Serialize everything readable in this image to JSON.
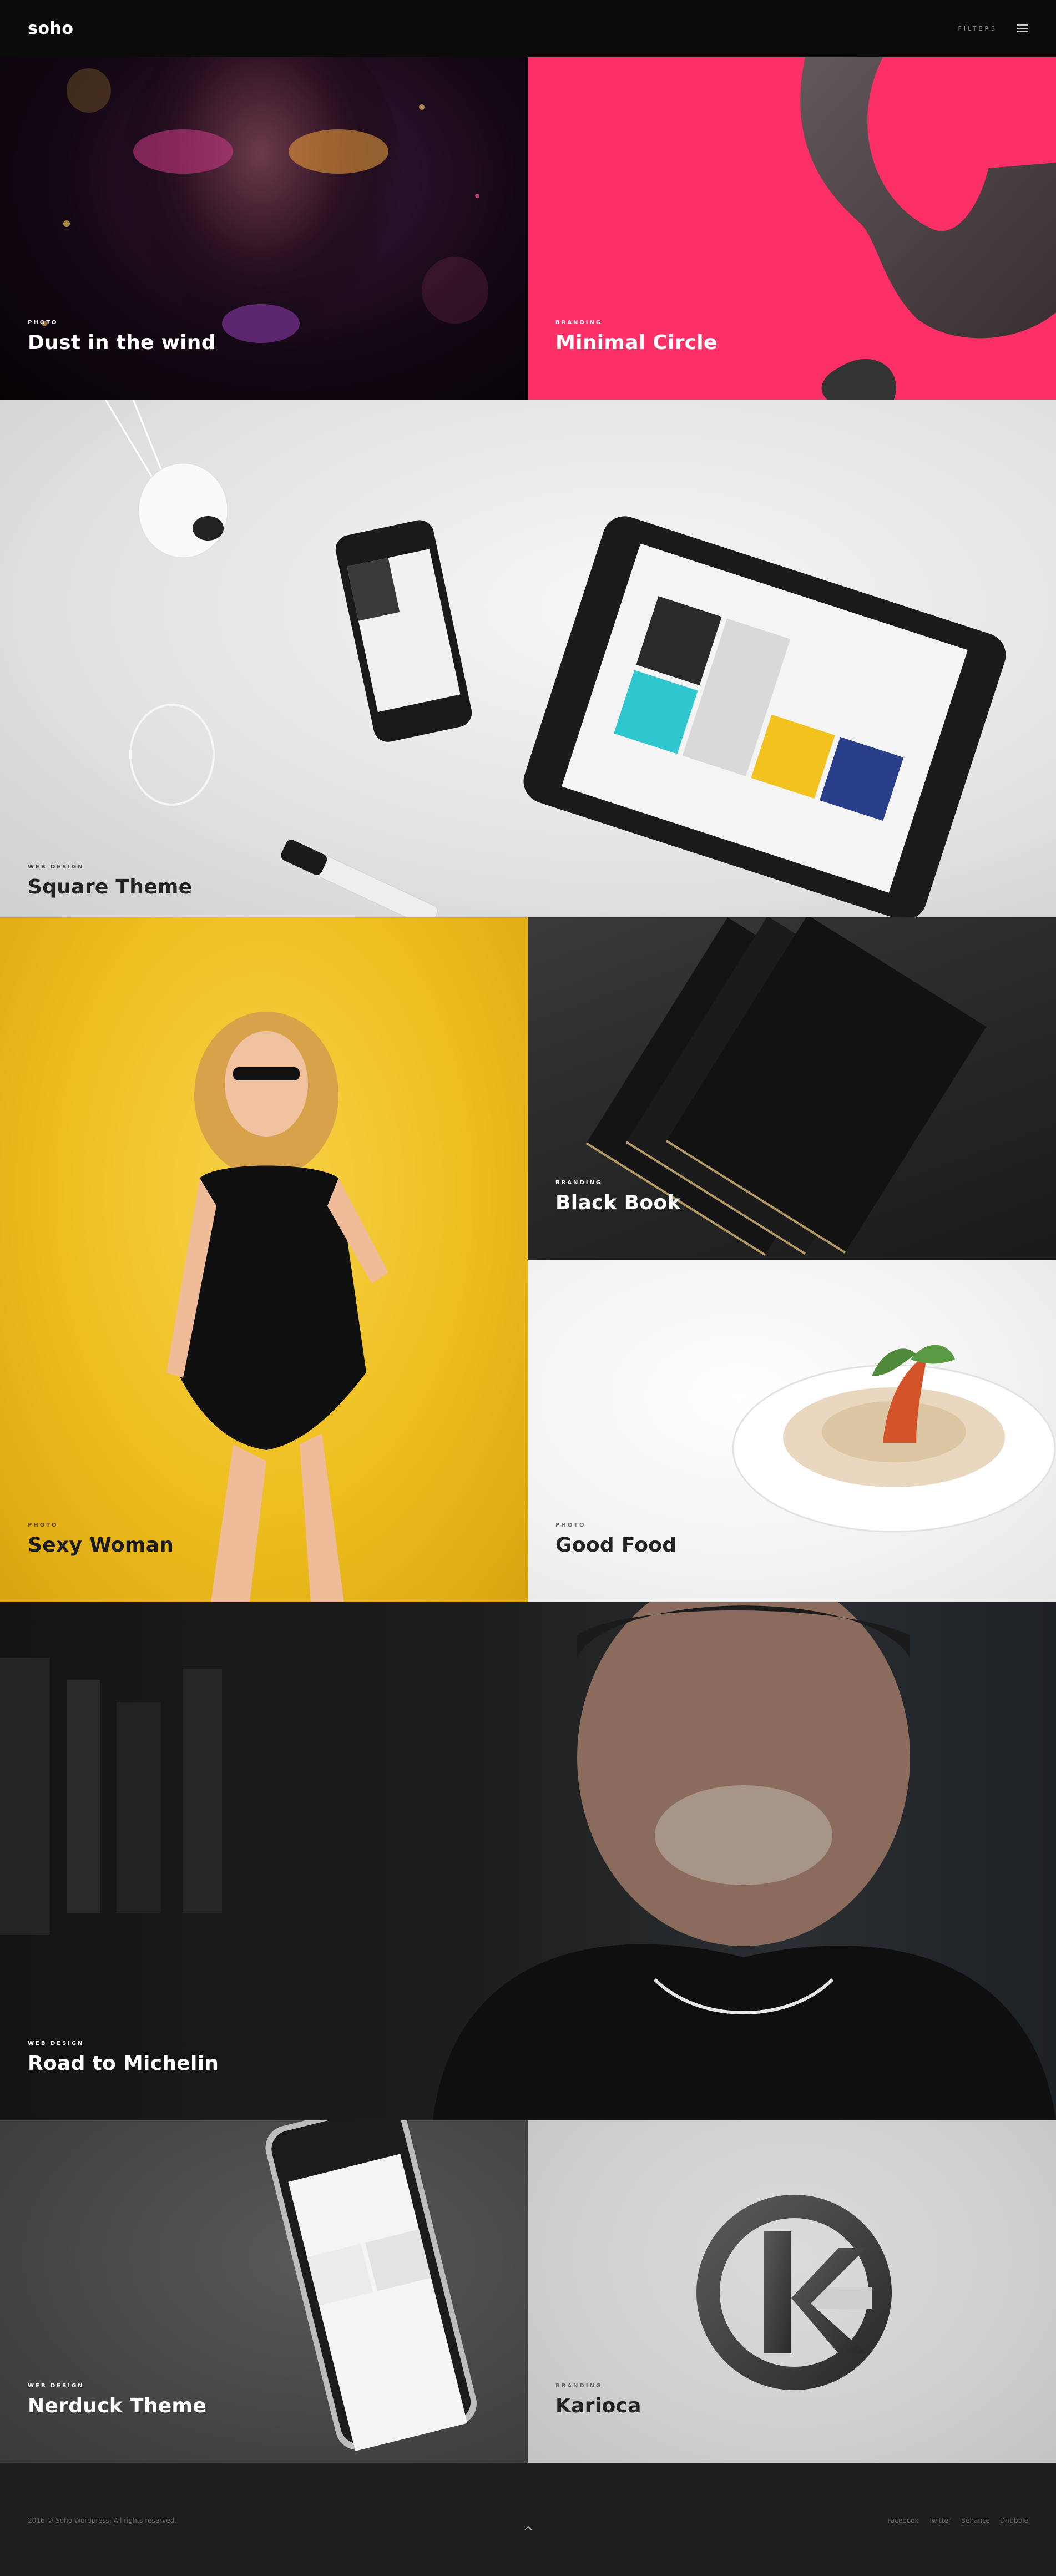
{
  "header": {
    "logo": "soho",
    "filters_label": "FILTERS"
  },
  "tiles": [
    {
      "category": "PHOTO",
      "title": "Dust in the wind"
    },
    {
      "category": "BRANDING",
      "title": "Minimal Circle"
    },
    {
      "category": "WEB DESIGN",
      "title": "Square Theme"
    },
    {
      "category": "PHOTO",
      "title": "Sexy Woman"
    },
    {
      "category": "BRANDING",
      "title": "Black Book"
    },
    {
      "category": "PHOTO",
      "title": "Good Food"
    },
    {
      "category": "WEB DESIGN",
      "title": "Road to Michelin"
    },
    {
      "category": "WEB DESIGN",
      "title": "Nerduck Theme"
    },
    {
      "category": "BRANDING",
      "title": "Karioca"
    }
  ],
  "footer": {
    "copyright": "2016 © Soho Wordpress. All rights reserved.",
    "social": [
      "Facebook",
      "Twitter",
      "Behance",
      "Dribbble"
    ]
  },
  "colors": {
    "header_bg": "#0b0b0b",
    "pink": "#fd2f67",
    "yellow": "#f2c21f",
    "footer_bg": "#1e1e1e"
  },
  "icons": {
    "menu": "hamburger-icon",
    "back_to_top": "chevron-up-icon"
  }
}
